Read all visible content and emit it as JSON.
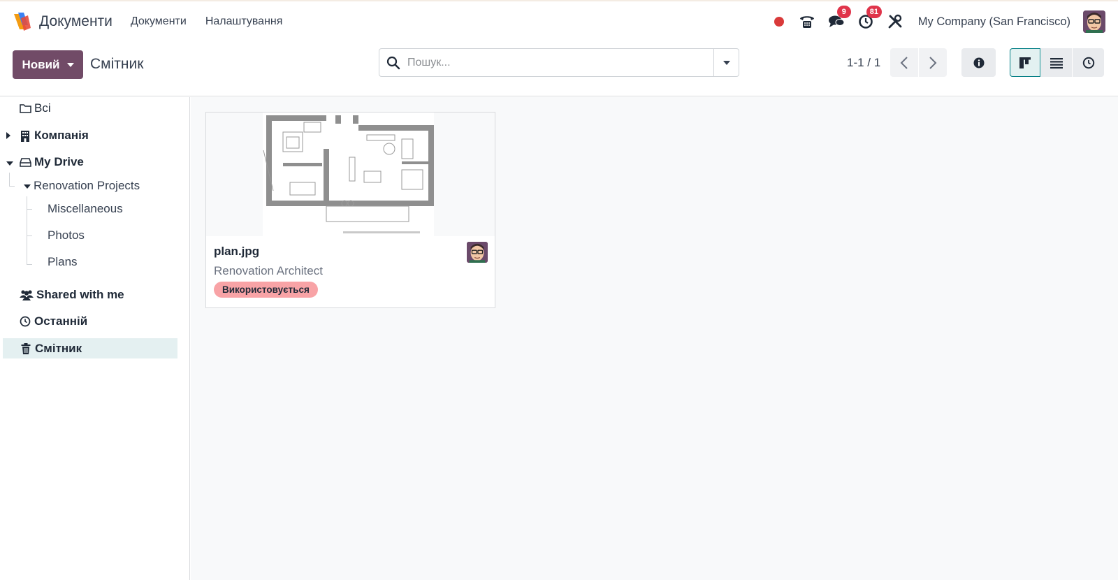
{
  "app": {
    "title": "Документи",
    "menu": [
      "Документи",
      "Налаштування"
    ]
  },
  "systray": {
    "messages_count": "9",
    "activities_count": "81",
    "company": "My Company (San Francisco)"
  },
  "control": {
    "new_label": "Новий",
    "breadcrumb": "Смітник",
    "search_placeholder": "Пошук...",
    "pager": "1-1 / 1"
  },
  "sidebar": {
    "all": "Всі",
    "company": "Компанія",
    "my_drive": "My Drive",
    "renovation": "Renovation Projects",
    "sub_items": [
      "Miscellaneous",
      "Photos",
      "Plans"
    ],
    "shared": "Shared with me",
    "recent": "Останній",
    "trash": "Смітник"
  },
  "documents": [
    {
      "name": "plan.jpg",
      "folder": "Renovation Architect",
      "tag": "Використовується"
    }
  ],
  "colors": {
    "brand": "#714b67",
    "accent": "#017e84",
    "tag_bg": "#f8a3a6",
    "badge": "#e0344a",
    "recording": "#d93a3a"
  }
}
